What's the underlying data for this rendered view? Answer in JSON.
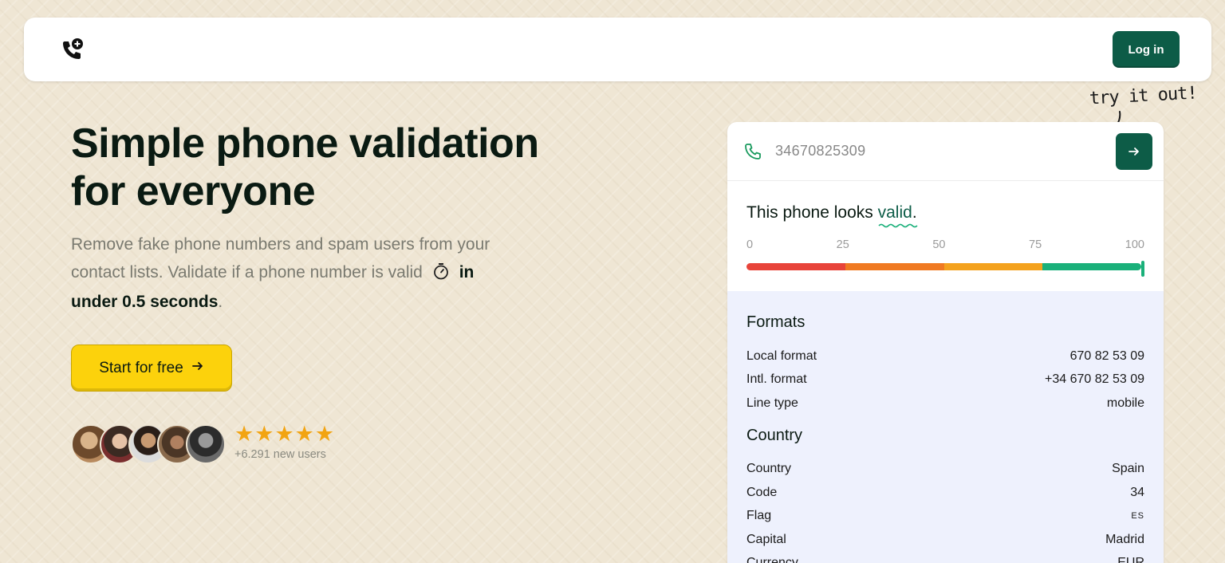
{
  "header": {
    "logo_icon": "phone-plus-icon",
    "login_label": "Log in"
  },
  "hero": {
    "title_line1": "Simple phone validation",
    "title_line2": "for everyone",
    "subtitle_part1": "Remove fake phone numbers and spam users from your contact lists. Validate if a phone number is valid",
    "subtitle_icon": "stopwatch-icon",
    "subtitle_strong": "in under 0.5 seconds",
    "subtitle_end": ".",
    "cta_label": "Start for free",
    "rating_stars": 5,
    "new_users": "+6.291 new users"
  },
  "annotation": {
    "text": "try it out!"
  },
  "validator": {
    "phone_value": "34670825309",
    "result_prefix": "This phone looks ",
    "result_word": "valid",
    "result_suffix": ".",
    "scale_labels": [
      "0",
      "25",
      "50",
      "75",
      "100"
    ],
    "score": 100,
    "bar_colors": [
      "#e8443a",
      "#f07a22",
      "#f4a21e",
      "#1ab07a"
    ],
    "formats_title": "Formats",
    "formats": [
      {
        "label": "Local format",
        "value": "670 82 53 09"
      },
      {
        "label": "Intl. format",
        "value": "+34 670 82 53 09"
      },
      {
        "label": "Line type",
        "value": "mobile"
      }
    ],
    "country_title": "Country",
    "country": [
      {
        "label": "Country",
        "value": "Spain"
      },
      {
        "label": "Code",
        "value": "34"
      },
      {
        "label": "Flag",
        "value": "ES"
      },
      {
        "label": "Capital",
        "value": "Madrid"
      },
      {
        "label": "Currency",
        "value": "EUR"
      }
    ]
  },
  "colors": {
    "brand_green": "#0d5c47",
    "cta_yellow": "#fcd20c",
    "star_orange": "#f2a412"
  }
}
